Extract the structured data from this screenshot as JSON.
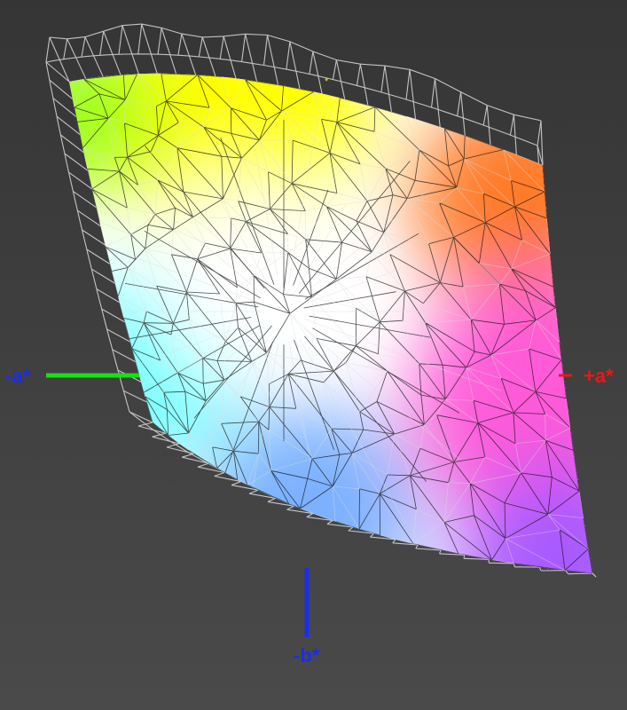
{
  "axes": {
    "neg_a": {
      "label": "-a*",
      "color": "#1a2ee8",
      "line_color": "#16e016"
    },
    "pos_a": {
      "label": "+a*",
      "color": "#e81818",
      "line_color": "#e81818"
    },
    "neg_b": {
      "label": "-b*",
      "color": "#1a2ee8",
      "line_color": "#1a2ee8"
    },
    "pos_b": {
      "label": "*",
      "color": "#f0f000"
    }
  },
  "colors": {
    "background_top": "#353535",
    "background_bottom": "#4a4a4a",
    "outer_wireframe": "#dcdcdc",
    "inner_wireframe": "#121212",
    "gamut_yellow": "#ffff00",
    "gamut_orange": "#ff7a28",
    "gamut_magenta": "#ff5ad8",
    "gamut_violet": "#a85aff",
    "gamut_blue": "#7ab0ff",
    "gamut_cyan": "#70ffff",
    "gamut_green": "#9cff1a",
    "gamut_white": "#ffffff"
  }
}
